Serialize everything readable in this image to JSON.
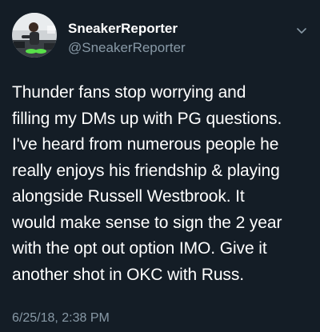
{
  "tweet": {
    "author": {
      "display_name": "SneakerReporter",
      "handle": "@SneakerReporter",
      "avatar": "profile-photo"
    },
    "menu_icon": "chevron-down-icon",
    "text_lines": [
      "Thunder fans stop worrying and",
      "filling my DMs up with PG questions.",
      "I've heard from numerous people he",
      "really enjoys his friendship & playing",
      "alongside Russell Westbrook. It",
      "would make sense to sign the 2 year",
      "with the opt out option IMO. Give it",
      "another shot in OKC with Russ."
    ],
    "timestamp": "6/25/18, 2:38 PM"
  },
  "colors": {
    "background": "#141d26",
    "primary_text": "#ffffff",
    "secondary_text": "#8899a6"
  }
}
